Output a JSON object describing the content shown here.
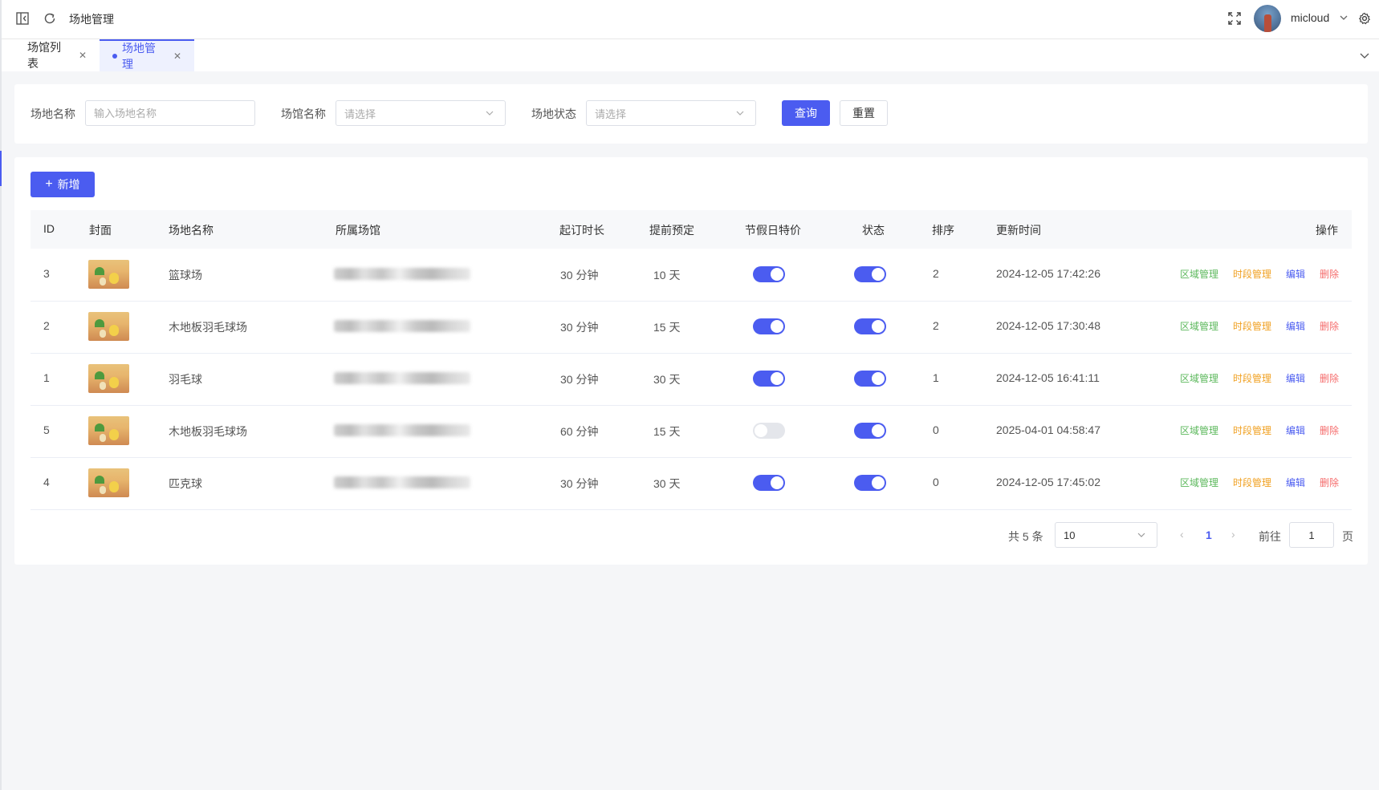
{
  "header": {
    "breadcrumb": "场地管理",
    "username": "micloud",
    "icons": [
      "sidebar-toggle-icon",
      "refresh-icon",
      "fullscreen-icon",
      "chevron-down-icon",
      "gear-icon"
    ]
  },
  "tabs": [
    {
      "label": "场馆列表",
      "active": false
    },
    {
      "label": "场地管理",
      "active": true
    }
  ],
  "search": {
    "venue_name_label": "场地名称",
    "venue_name_placeholder": "输入场地名称",
    "stadium_label": "场馆名称",
    "stadium_placeholder": "请选择",
    "status_label": "场地状态",
    "status_placeholder": "请选择",
    "query_button": "查询",
    "reset_button": "重置"
  },
  "toolbar": {
    "add_button": "新增"
  },
  "table": {
    "columns": [
      "ID",
      "封面",
      "场地名称",
      "所属场馆",
      "起订时长",
      "提前预定",
      "节假日特价",
      "状态",
      "排序",
      "更新时间",
      "操作"
    ],
    "rows": [
      {
        "id": "3",
        "name": "篮球场",
        "duration": "30 分钟",
        "advance": "10 天",
        "holiday": true,
        "status": true,
        "sort": "2",
        "updated": "2024-12-05 17:42:26"
      },
      {
        "id": "2",
        "name": "木地板羽毛球场",
        "duration": "30 分钟",
        "advance": "15 天",
        "holiday": true,
        "status": true,
        "sort": "2",
        "updated": "2024-12-05 17:30:48"
      },
      {
        "id": "1",
        "name": "羽毛球",
        "duration": "30 分钟",
        "advance": "30 天",
        "holiday": true,
        "status": true,
        "sort": "1",
        "updated": "2024-12-05 16:41:11"
      },
      {
        "id": "5",
        "name": "木地板羽毛球场",
        "duration": "60 分钟",
        "advance": "15 天",
        "holiday": false,
        "status": true,
        "sort": "0",
        "updated": "2025-04-01 04:58:47"
      },
      {
        "id": "4",
        "name": "匹克球",
        "duration": "30 分钟",
        "advance": "30 天",
        "holiday": true,
        "status": true,
        "sort": "0",
        "updated": "2024-12-05 17:45:02"
      }
    ],
    "actions": {
      "area": "区域管理",
      "time": "时段管理",
      "edit": "编辑",
      "delete": "删除"
    }
  },
  "pagination": {
    "total": "共 5 条",
    "page_size": "10",
    "current_page": "1",
    "goto_label": "前往",
    "goto_value": "1",
    "page_suffix": "页"
  },
  "colors": {
    "primary": "#4b5cf0",
    "area": "#5cb85c",
    "time": "#f0a020",
    "edit": "#4b5cf0",
    "delete": "#f56c6c"
  }
}
